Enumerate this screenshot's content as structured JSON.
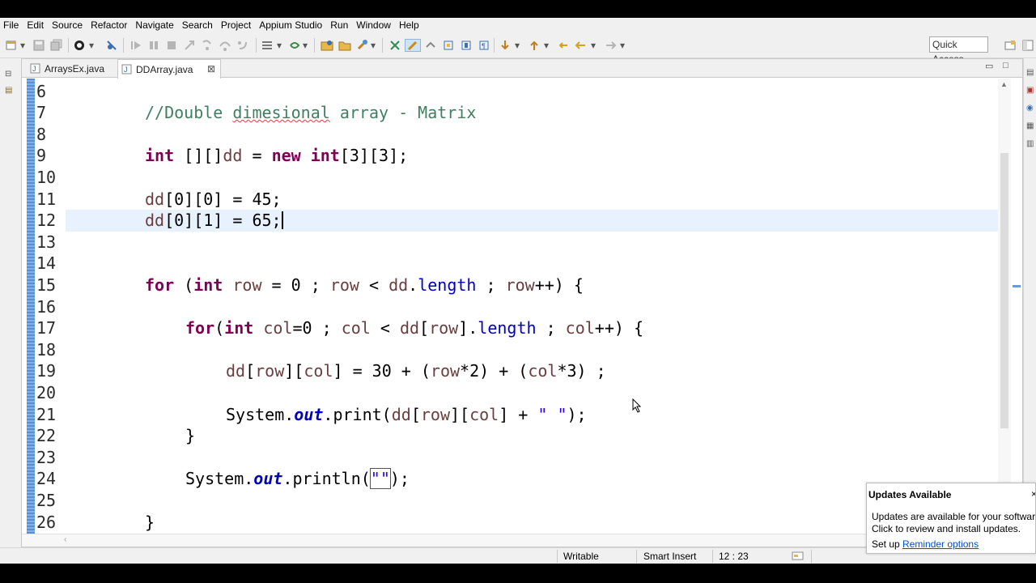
{
  "menu": [
    "File",
    "Edit",
    "Source",
    "Refactor",
    "Navigate",
    "Search",
    "Project",
    "Appium Studio",
    "Run",
    "Window",
    "Help"
  ],
  "toolbar": {
    "quick_access_label": "Quick Access"
  },
  "tabs": [
    {
      "label": "ArraysEx.java",
      "active": false
    },
    {
      "label": "DDArray.java",
      "active": true,
      "close": "⊠"
    }
  ],
  "editor": {
    "lines": [
      {
        "num": "6"
      },
      {
        "num": "7"
      },
      {
        "num": "8"
      },
      {
        "num": "9"
      },
      {
        "num": "10"
      },
      {
        "num": "11"
      },
      {
        "num": "12"
      },
      {
        "num": "13"
      },
      {
        "num": "14"
      },
      {
        "num": "15"
      },
      {
        "num": "16"
      },
      {
        "num": "17"
      },
      {
        "num": "18"
      },
      {
        "num": "19"
      },
      {
        "num": "20"
      },
      {
        "num": "21"
      },
      {
        "num": "22"
      },
      {
        "num": "23"
      },
      {
        "num": "24"
      },
      {
        "num": "25"
      },
      {
        "num": "26"
      }
    ],
    "code": {
      "l7_comment_a": "//Double ",
      "l7_comment_b": "dimesional",
      "l7_comment_c": " array - Matrix",
      "l9_kw1": "int",
      "l9_a": " [][]",
      "l9_var": "dd",
      "l9_b": " = ",
      "l9_kw2": "new",
      "l9_kw3": " int",
      "l9_c": "[3][3];",
      "l11_var": "dd",
      "l11_rest": "[0][0] = 45;",
      "l12_var": "dd",
      "l12_rest": "[0][1] = 65;",
      "l15_kw": "for",
      "l15_a": " (",
      "l15_kw2": "int",
      "l15_var1": " row",
      "l15_b": " = 0 ; ",
      "l15_var2": "row",
      "l15_c": " < ",
      "l15_var3": "dd",
      "l15_d": ".",
      "l15_fld": "length",
      "l15_e": " ; ",
      "l15_var4": "row",
      "l15_f": "++) {",
      "l17_kw": "for",
      "l17_a": "(",
      "l17_kw2": "int",
      "l17_var1": " col",
      "l17_b": "=0 ; ",
      "l17_var2": "col",
      "l17_c": " < ",
      "l17_var3": "dd",
      "l17_d": "[",
      "l17_var4": "row",
      "l17_e": "].",
      "l17_fld": "length",
      "l17_f": " ; ",
      "l17_var5": "col",
      "l17_g": "++) {",
      "l19_var1": "dd",
      "l19_a": "[",
      "l19_var2": "row",
      "l19_b": "][",
      "l19_var3": "col",
      "l19_c": "] = 30 + (",
      "l19_var4": "row",
      "l19_d": "*2) + (",
      "l19_var5": "col",
      "l19_e": "*3) ;",
      "l21_a": "System.",
      "l21_out": "out",
      "l21_b": ".print(",
      "l21_var1": "dd",
      "l21_c": "[",
      "l21_var2": "row",
      "l21_d": "][",
      "l21_var3": "col",
      "l21_e": "] + ",
      "l21_str": "\" \"",
      "l21_f": ");",
      "l22": "}",
      "l24_a": "System.",
      "l24_out": "out",
      "l24_b": ".println(",
      "l24_str": "\"\"",
      "l24_c": ");",
      "l26": "}"
    }
  },
  "status": {
    "writable": "Writable",
    "insert_mode": "Smart Insert",
    "position": "12 : 23"
  },
  "popup": {
    "title": "Updates Available",
    "close": "×",
    "body_line1": "Updates are available for your softwar",
    "body_line2": "Click to review and install updates.",
    "setup_label": "Set up ",
    "link": "Reminder options"
  },
  "colors": {
    "keyword": "#7f0055",
    "comment": "#3f7f5f",
    "local_var": "#6a3e3e",
    "field": "#0000c0",
    "string": "#2a00ff",
    "current_line": "#e8f2fe"
  }
}
